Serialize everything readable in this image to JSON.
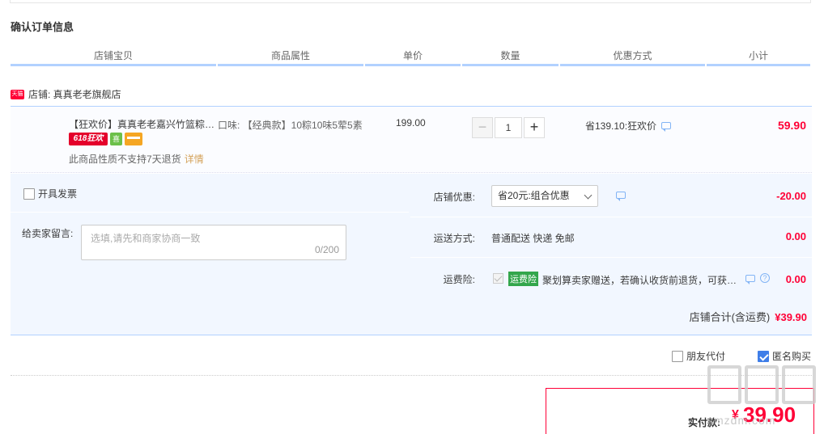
{
  "section_title": "确认订单信息",
  "columns": [
    "店铺宝贝",
    "商品属性",
    "单价",
    "数量",
    "优惠方式",
    "小计"
  ],
  "shop": {
    "badge": "天猫",
    "label": "店铺: 真真老老旗舰店"
  },
  "item": {
    "title": "【狂欢价】真真老老嘉兴竹篮粽子礼盒",
    "promo_tag": "618狂欢",
    "promo_icon": "喜",
    "return_note": "此商品性质不支持7天退货",
    "return_detail": "详情",
    "attribute": "口味: 【经典款】10粽10味5荤5素",
    "unit_price": "199.00",
    "quantity": "1",
    "qty_minus": "−",
    "qty_plus": "+",
    "discount": "省139.10:狂欢价",
    "subtotal": "59.90"
  },
  "invoice_label": "开具发票",
  "memo": {
    "label": "给卖家留言:",
    "placeholder": "选填,请先和商家协商一致",
    "counter": "0/200"
  },
  "shop_discount": {
    "label": "店铺优惠:",
    "selected": "省20元:组合优惠",
    "amount": "-20.00"
  },
  "shipping": {
    "label": "运送方式:",
    "text": "普通配送 快递 免邮",
    "amount": "0.00"
  },
  "insurance": {
    "label": "运费险:",
    "badge": "运费险",
    "text": "聚划算卖家赠送，若确认收货前退货，可获保险赔付",
    "amount": "0.00"
  },
  "shop_total": {
    "label": "店铺合计(含运费)",
    "value": "¥39.90"
  },
  "options": {
    "friend_pay": "朋友代付",
    "anonymous": "匿名购买"
  },
  "payment": {
    "label": "实付款:",
    "currency": "¥",
    "total": "39.90"
  },
  "watermark": {
    "site": "smzdm.com"
  },
  "colors": {
    "accent": "#ff0036",
    "header_rule": "#b2d1ff",
    "panel_bg": "#f2f7ff"
  }
}
